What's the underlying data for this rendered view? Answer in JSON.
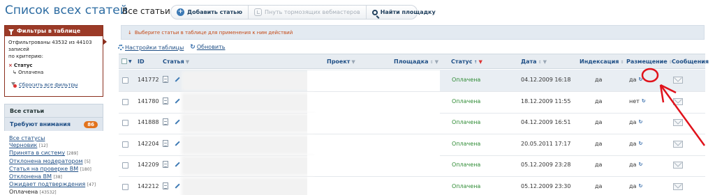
{
  "page_title": "Список всех статей",
  "filters": {
    "title": "Фильтры в таблице",
    "summary_line1": "Отфильтрованы 43532 из 44103",
    "summary_line2": "записей",
    "summary_line3": "по критерию:",
    "criterion_name": "Статус",
    "criterion_value": "Оплачена",
    "reset_label": "Сбросить все фильтры"
  },
  "nav": {
    "all_articles": "Все статьи",
    "need_attention": "Требуют внимания",
    "need_attention_count": "86"
  },
  "status_links": [
    {
      "label": "Все статусы",
      "count": ""
    },
    {
      "label": "Черновик",
      "count": "[12]"
    },
    {
      "label": "Принята в систему",
      "count": "[289]"
    },
    {
      "label": "Отклонена модератором",
      "count": "[5]"
    },
    {
      "label": "Статья на проверке ВМ",
      "count": "[180]"
    },
    {
      "label": "Отклонена ВМ",
      "count": "[38]"
    },
    {
      "label": "Ожидает подтверждения",
      "count": "[47]"
    },
    {
      "label": "Оплачена",
      "count": "[43532]"
    }
  ],
  "main": {
    "title": "Все статьи",
    "toolbar": {
      "add_article": "Добавить статью",
      "poke_webmasters": "Пнуть тормозящих вебмастеров",
      "find_site": "Найти площадку"
    },
    "notice": "Выберите статьи в таблице для применения к ним действий",
    "table_settings": "Настройки таблицы",
    "refresh": "Обновить"
  },
  "table": {
    "columns": {
      "id": "ID",
      "article": "Статья",
      "project": "Проект",
      "site": "Площадка",
      "status": "Статус",
      "date": "Дата",
      "indexing": "Индексация",
      "placement": "Размещение",
      "messages": "Сообщения"
    },
    "rows": [
      {
        "id": "141772",
        "status": "Оплачена",
        "date": "04.12.2009 16:18",
        "indexing": "да",
        "placement": "да"
      },
      {
        "id": "141780",
        "status": "Оплачена",
        "date": "18.12.2009 11:55",
        "indexing": "да",
        "placement": "нет"
      },
      {
        "id": "141888",
        "status": "Оплачена",
        "date": "04.12.2009 16:51",
        "indexing": "да",
        "placement": "да"
      },
      {
        "id": "142204",
        "status": "Оплачена",
        "date": "20.05.2011 17:17",
        "indexing": "да",
        "placement": "да"
      },
      {
        "id": "142209",
        "status": "Оплачена",
        "date": "05.12.2009 23:28",
        "indexing": "да",
        "placement": "да"
      },
      {
        "id": "142212",
        "status": "Оплачена",
        "date": "05.12.2009 23:30",
        "indexing": "да",
        "placement": "да"
      }
    ]
  },
  "colors": {
    "title_blue": "#2d6ca2",
    "filter_header": "#9b3a27",
    "badge_orange": "#e2731d",
    "status_green": "#2e8b34",
    "annotation_red": "#e0121b"
  }
}
